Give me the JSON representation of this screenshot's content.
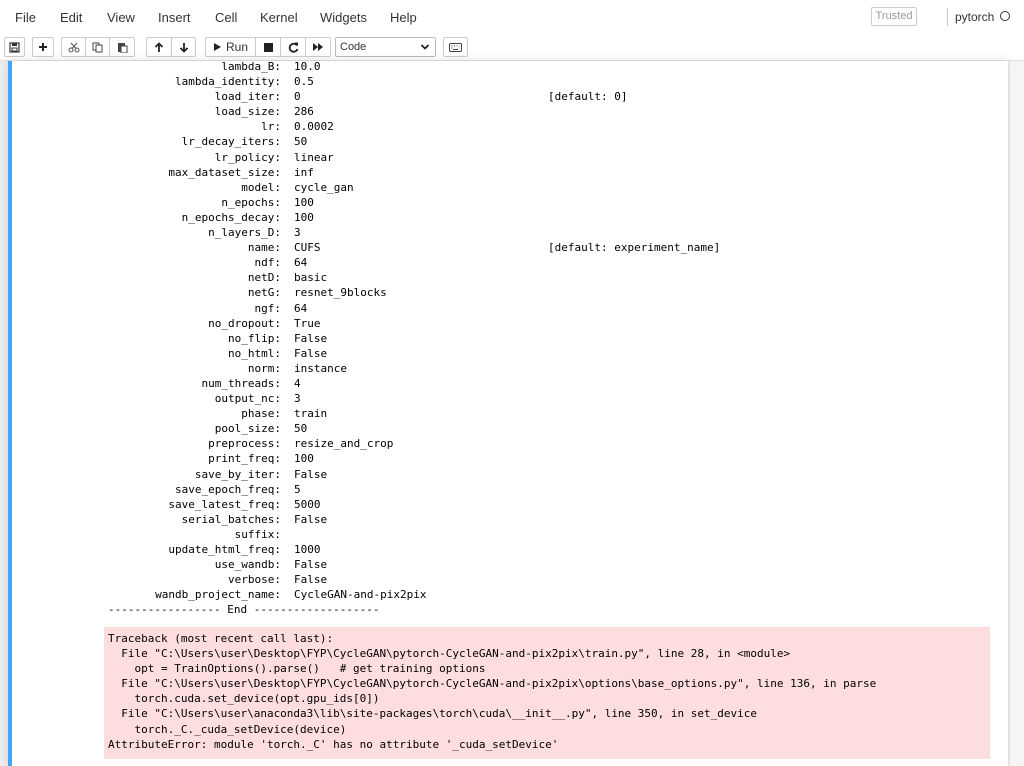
{
  "menubar": {
    "items": [
      "File",
      "Edit",
      "View",
      "Insert",
      "Cell",
      "Kernel",
      "Widgets",
      "Help"
    ],
    "trusted_label": "Trusted",
    "kernel_name": "pytorch"
  },
  "toolbar": {
    "run_label": "Run",
    "cell_type": "Code",
    "icons": [
      "save-icon",
      "plus-icon",
      "cut-icon",
      "copy-icon",
      "paste-icon",
      "arrow-up-icon",
      "arrow-down-icon",
      "run-icon",
      "stop-icon",
      "restart-icon",
      "fast-forward-icon",
      "keyboard-icon"
    ]
  },
  "output": {
    "options": [
      {
        "key": "lambda_B:",
        "value": "10.0",
        "default": ""
      },
      {
        "key": "lambda_identity:",
        "value": "0.5",
        "default": ""
      },
      {
        "key": "load_iter:",
        "value": "0",
        "default": "[default: 0]"
      },
      {
        "key": "load_size:",
        "value": "286",
        "default": ""
      },
      {
        "key": "lr:",
        "value": "0.0002",
        "default": ""
      },
      {
        "key": "lr_decay_iters:",
        "value": "50",
        "default": ""
      },
      {
        "key": "lr_policy:",
        "value": "linear",
        "default": ""
      },
      {
        "key": "max_dataset_size:",
        "value": "inf",
        "default": ""
      },
      {
        "key": "model:",
        "value": "cycle_gan",
        "default": ""
      },
      {
        "key": "n_epochs:",
        "value": "100",
        "default": ""
      },
      {
        "key": "n_epochs_decay:",
        "value": "100",
        "default": ""
      },
      {
        "key": "n_layers_D:",
        "value": "3",
        "default": ""
      },
      {
        "key": "name:",
        "value": "CUFS",
        "default": "[default: experiment_name]"
      },
      {
        "key": "ndf:",
        "value": "64",
        "default": ""
      },
      {
        "key": "netD:",
        "value": "basic",
        "default": ""
      },
      {
        "key": "netG:",
        "value": "resnet_9blocks",
        "default": ""
      },
      {
        "key": "ngf:",
        "value": "64",
        "default": ""
      },
      {
        "key": "no_dropout:",
        "value": "True",
        "default": ""
      },
      {
        "key": "no_flip:",
        "value": "False",
        "default": ""
      },
      {
        "key": "no_html:",
        "value": "False",
        "default": ""
      },
      {
        "key": "norm:",
        "value": "instance",
        "default": ""
      },
      {
        "key": "num_threads:",
        "value": "4",
        "default": ""
      },
      {
        "key": "output_nc:",
        "value": "3",
        "default": ""
      },
      {
        "key": "phase:",
        "value": "train",
        "default": ""
      },
      {
        "key": "pool_size:",
        "value": "50",
        "default": ""
      },
      {
        "key": "preprocess:",
        "value": "resize_and_crop",
        "default": ""
      },
      {
        "key": "print_freq:",
        "value": "100",
        "default": ""
      },
      {
        "key": "save_by_iter:",
        "value": "False",
        "default": ""
      },
      {
        "key": "save_epoch_freq:",
        "value": "5",
        "default": ""
      },
      {
        "key": "save_latest_freq:",
        "value": "5000",
        "default": ""
      },
      {
        "key": "serial_batches:",
        "value": "False",
        "default": ""
      },
      {
        "key": "suffix:",
        "value": "",
        "default": ""
      },
      {
        "key": "update_html_freq:",
        "value": "1000",
        "default": ""
      },
      {
        "key": "use_wandb:",
        "value": "False",
        "default": ""
      },
      {
        "key": "verbose:",
        "value": "False",
        "default": ""
      },
      {
        "key": "wandb_project_name:",
        "value": "CycleGAN-and-pix2pix",
        "default": ""
      }
    ],
    "end_line": "----------------- End -------------------",
    "traceback": [
      "Traceback (most recent call last):",
      "  File \"C:\\Users\\user\\Desktop\\FYP\\CycleGAN\\pytorch-CycleGAN-and-pix2pix\\train.py\", line 28, in <module>",
      "    opt = TrainOptions().parse()   # get training options",
      "  File \"C:\\Users\\user\\Desktop\\FYP\\CycleGAN\\pytorch-CycleGAN-and-pix2pix\\options\\base_options.py\", line 136, in parse",
      "    torch.cuda.set_device(opt.gpu_ids[0])",
      "  File \"C:\\Users\\user\\anaconda3\\lib\\site-packages\\torch\\cuda\\__init__.py\", line 350, in set_device",
      "    torch._C._cuda_setDevice(device)",
      "AttributeError: module 'torch._C' has no attribute '_cuda_setDevice'"
    ]
  }
}
